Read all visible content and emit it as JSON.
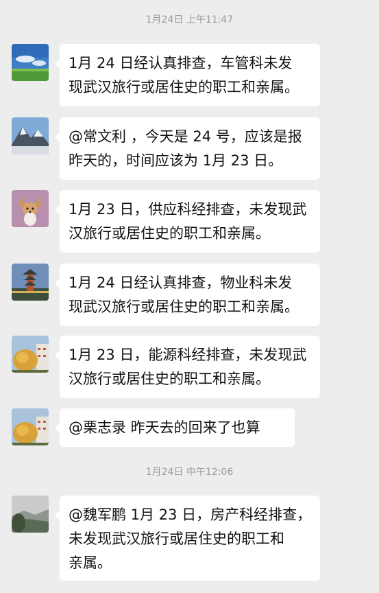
{
  "timestamps": [
    "1月24日 上午11:47",
    "1月24日 中午12:06"
  ],
  "messages": [
    {
      "lines": [
        "1月 24 日经认真排查，车管科未发",
        "现武汉旅行或居住史的职工和亲属。"
      ]
    },
    {
      "lines": [
        "@常文利 ，今天是 24 号，应该是报",
        "昨天的，时间应该为 1月 23 日。"
      ]
    },
    {
      "lines": [
        "1月 23 日，供应科经排查，未发现武",
        "汉旅行或居住史的职工和亲属。"
      ]
    },
    {
      "lines": [
        "1月 24 日经认真排查，物业科未发",
        "现武汉旅行或居住史的职工和亲属。"
      ]
    },
    {
      "lines": [
        "1月 23 日，能源科经排查，未发现武",
        "汉旅行或居住史的职工和亲属。"
      ]
    },
    {
      "lines": [
        "@栗志录  昨天去的回来了也算"
      ]
    },
    {
      "lines": [
        "@魏军鹏 1月 23 日，房产科经排查，",
        "未发现武汉旅行或居住史的职工和",
        "亲属。"
      ]
    }
  ]
}
